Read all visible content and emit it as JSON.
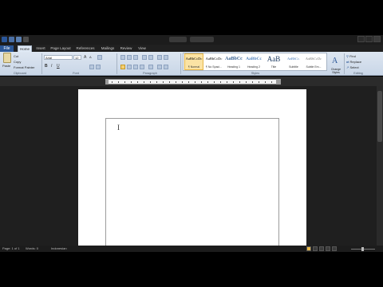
{
  "app": {
    "accent": "#2b5797"
  },
  "tabs": [
    {
      "label": "File"
    },
    {
      "label": "Home"
    },
    {
      "label": "Insert"
    },
    {
      "label": "Page Layout"
    },
    {
      "label": "References"
    },
    {
      "label": "Mailings"
    },
    {
      "label": "Review"
    },
    {
      "label": "View"
    }
  ],
  "clipboard": {
    "paste_label": "Paste",
    "cut_label": "Cut",
    "copy_label": "Copy",
    "format_painter_label": "Format Painter",
    "group_label": "Clipboard"
  },
  "font": {
    "name_value": "Arial",
    "size_value": "12",
    "grow_label": "A",
    "shrink_label": "A",
    "bold_label": "B",
    "italic_label": "I",
    "underline_label": "U",
    "group_label": "Font"
  },
  "paragraph": {
    "group_label": "Paragraph"
  },
  "styles": {
    "group_label": "Styles",
    "items": [
      {
        "sample": "AaBbCcDc",
        "name": "¶ Normal"
      },
      {
        "sample": "AaBbCcDc",
        "name": "¶ No Spaci..."
      },
      {
        "sample": "AaBbCc",
        "name": "Heading 1"
      },
      {
        "sample": "AaBbCc",
        "name": "Heading 2"
      },
      {
        "sample": "AaB",
        "name": "Title"
      },
      {
        "sample": "AaBbCc.",
        "name": "Subtitle"
      },
      {
        "sample": "AaBbCcDc",
        "name": "Subtle Em..."
      }
    ],
    "change_styles_label": "Change Styles"
  },
  "editing": {
    "find_label": "Find",
    "replace_label": "Replace",
    "select_label": "Select",
    "group_label": "Editing"
  },
  "document": {
    "cursor_glyph": "I"
  },
  "status": {
    "page": "Page: 1 of 1",
    "words": "Words: 0",
    "language": "Indonesian"
  }
}
